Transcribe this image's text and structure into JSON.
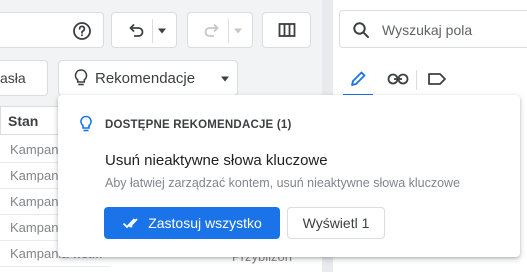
{
  "toolbar": {
    "filter_label_partial": "asła",
    "recommendations_label": "Rekomendacje"
  },
  "search": {
    "placeholder": "Wyszukaj pola"
  },
  "table": {
    "status_header": "Stan",
    "rows": [
      "Kampan",
      "Kampan",
      "Kampan",
      "Kampan",
      "Kampania wst..."
    ],
    "right_partial": "Przybliżon"
  },
  "popup": {
    "header": "DOSTĘPNE REKOMENDACJE (1)",
    "title": "Usuń nieaktywne słowa kluczowe",
    "description": "Aby łatwiej zarządzać kontem, usuń nieaktywne słowa kluczowe",
    "apply_all_label": "Zastosuj wszystko",
    "view_label": "Wyświetl 1"
  },
  "colors": {
    "accent": "#1a73e8"
  }
}
